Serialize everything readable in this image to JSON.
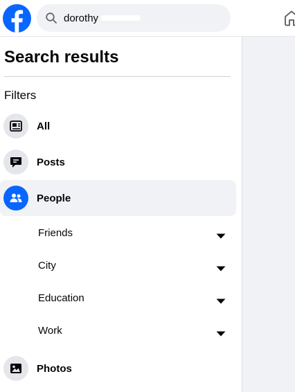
{
  "colors": {
    "brand": "#0866ff",
    "icon_bg": "#e4e6eb",
    "active_bg": "#f0f2f5",
    "text": "#050505",
    "panel_bg": "#f0f2f5"
  },
  "header": {
    "logo_icon": "facebook-logo-icon",
    "search": {
      "icon": "search-icon",
      "query": "dorothy"
    },
    "home_icon": "home-icon"
  },
  "sidebar": {
    "title": "Search results",
    "filters_label": "Filters",
    "items": [
      {
        "label": "All",
        "icon": "all-feed-icon",
        "active": false
      },
      {
        "label": "Posts",
        "icon": "posts-chat-icon",
        "active": false
      },
      {
        "label": "People",
        "icon": "people-icon",
        "active": true
      },
      {
        "label": "Photos",
        "icon": "photos-icon",
        "active": false
      }
    ],
    "people_filters": [
      {
        "label": "Friends",
        "icon": "caret-down-icon"
      },
      {
        "label": "City",
        "icon": "caret-down-icon"
      },
      {
        "label": "Education",
        "icon": "caret-down-icon"
      },
      {
        "label": "Work",
        "icon": "caret-down-icon"
      }
    ]
  }
}
